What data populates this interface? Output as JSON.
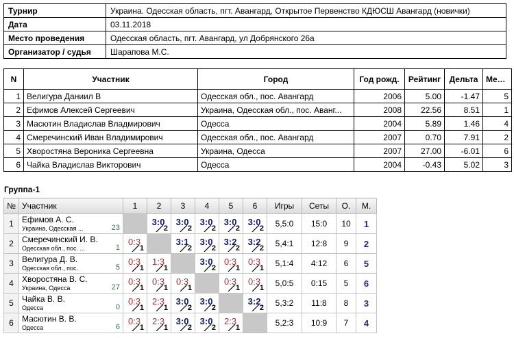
{
  "info": [
    {
      "label": "Турнир",
      "value": "Украина. Одесская область, пгт. Авангард, Открытое Первенство КДЮСШ Авангард (новички)"
    },
    {
      "label": "Дата",
      "value": "03.11.2018"
    },
    {
      "label": "Место проведения",
      "value": "Одесская область, пгт. Авангард, ул Добрянского 26а"
    },
    {
      "label": "Организатор / судья",
      "value": "Шарапова М.С."
    }
  ],
  "participants": {
    "headers": [
      "N",
      "Участник",
      "Город",
      "Год рожд.",
      "Рейтинг",
      "Дельта",
      "Место"
    ],
    "rows": [
      {
        "n": "1",
        "name": "Велигура Даниил В",
        "city": "Одесская обл., пос. Авангард",
        "year": "2006",
        "rating": "5.00",
        "delta": "-1.47",
        "place": "5"
      },
      {
        "n": "2",
        "name": "Ефимов Алексей Сергеевич",
        "city": "Украина, Одесская обл., пос. Аванг...",
        "year": "2008",
        "rating": "22.56",
        "delta": "8.51",
        "place": "1"
      },
      {
        "n": "3",
        "name": "Масютин Владислав Владмирович",
        "city": "Одесса",
        "year": "2004",
        "rating": "5.89",
        "delta": "1.46",
        "place": "4"
      },
      {
        "n": "4",
        "name": "Смеречинский Иван Владимирович",
        "city": "Одесская обл., пос. Авангард",
        "year": "2007",
        "rating": "0.70",
        "delta": "7.91",
        "place": "2"
      },
      {
        "n": "5",
        "name": "Хворостяна Вероника Сергеевна",
        "city": "Украина, Одесса",
        "year": "2007",
        "rating": "27.00",
        "delta": "-6.01",
        "place": "6"
      },
      {
        "n": "6",
        "name": "Чайка Владислав Викторович",
        "city": "Одесса",
        "year": "2004",
        "rating": "-0.43",
        "delta": "5.02",
        "place": "3"
      }
    ]
  },
  "group": {
    "title": "Группа-1",
    "headers": {
      "n": "№",
      "name": "Участник",
      "cols": [
        "1",
        "2",
        "3",
        "4",
        "5",
        "6"
      ],
      "games": "Игры",
      "sets": "Сеты",
      "points": "О.",
      "place": "М."
    },
    "rows": [
      {
        "n": "1",
        "name": "Ефимов А. С.",
        "city": "Украина, Одесская ...",
        "rating": "23",
        "cells": [
          null,
          {
            "s": "3:0",
            "r": "2"
          },
          {
            "s": "3:0",
            "r": "2"
          },
          {
            "s": "3:0",
            "r": "2"
          },
          {
            "s": "3:0",
            "r": "2"
          },
          {
            "s": "3:0",
            "r": "2"
          }
        ],
        "games": "5,5:0",
        "sets": "15:0",
        "points": "10",
        "place": "1"
      },
      {
        "n": "2",
        "name": "Смеречинский И. В.",
        "city": "Одесская обл., пос. ...",
        "rating": "1",
        "cells": [
          {
            "s": "0:3",
            "r": "1"
          },
          null,
          {
            "s": "3:1",
            "r": "2"
          },
          {
            "s": "3:0",
            "r": "2"
          },
          {
            "s": "3:2",
            "r": "2"
          },
          {
            "s": "3:2",
            "r": "2"
          }
        ],
        "games": "5,4:1",
        "sets": "12:8",
        "points": "9",
        "place": "2"
      },
      {
        "n": "3",
        "name": "Велигура Д. В.",
        "city": "Одесская обл., пос.",
        "rating": "5",
        "cells": [
          {
            "s": "0:3",
            "r": "1"
          },
          {
            "s": "1:3",
            "r": "1"
          },
          null,
          {
            "s": "3:0",
            "r": "2"
          },
          {
            "s": "0:3",
            "r": "1"
          },
          {
            "s": "0:3",
            "r": "1"
          }
        ],
        "games": "5,1:4",
        "sets": "4:12",
        "points": "6",
        "place": "5"
      },
      {
        "n": "4",
        "name": "Хворостяна В. С.",
        "city": "Украина, Одесса",
        "rating": "27",
        "cells": [
          {
            "s": "0:3",
            "r": "1"
          },
          {
            "s": "0:3",
            "r": "1"
          },
          {
            "s": "0:3",
            "r": "1"
          },
          null,
          {
            "s": "0:3",
            "r": "1"
          },
          {
            "s": "0:3",
            "r": "1"
          }
        ],
        "games": "5,0:5",
        "sets": "0:15",
        "points": "5",
        "place": "6"
      },
      {
        "n": "5",
        "name": "Чайка В. В.",
        "city": "Одесса",
        "rating": "0",
        "cells": [
          {
            "s": "0:3",
            "r": "1"
          },
          {
            "s": "2:3",
            "r": "1"
          },
          {
            "s": "3:0",
            "r": "2"
          },
          {
            "s": "3:0",
            "r": "2"
          },
          null,
          {
            "s": "3:2",
            "r": "2"
          }
        ],
        "games": "5,3:2",
        "sets": "11:8",
        "points": "8",
        "place": "3"
      },
      {
        "n": "6",
        "name": "Масютин В. В.",
        "city": "Одесса",
        "rating": "6",
        "cells": [
          {
            "s": "0:3",
            "r": "1"
          },
          {
            "s": "2:3",
            "r": "1"
          },
          {
            "s": "3:0",
            "r": "2"
          },
          {
            "s": "3:0",
            "r": "2"
          },
          {
            "s": "2:3",
            "r": "1"
          },
          null
        ],
        "games": "5,2:3",
        "sets": "10:9",
        "points": "7",
        "place": "4"
      }
    ]
  }
}
